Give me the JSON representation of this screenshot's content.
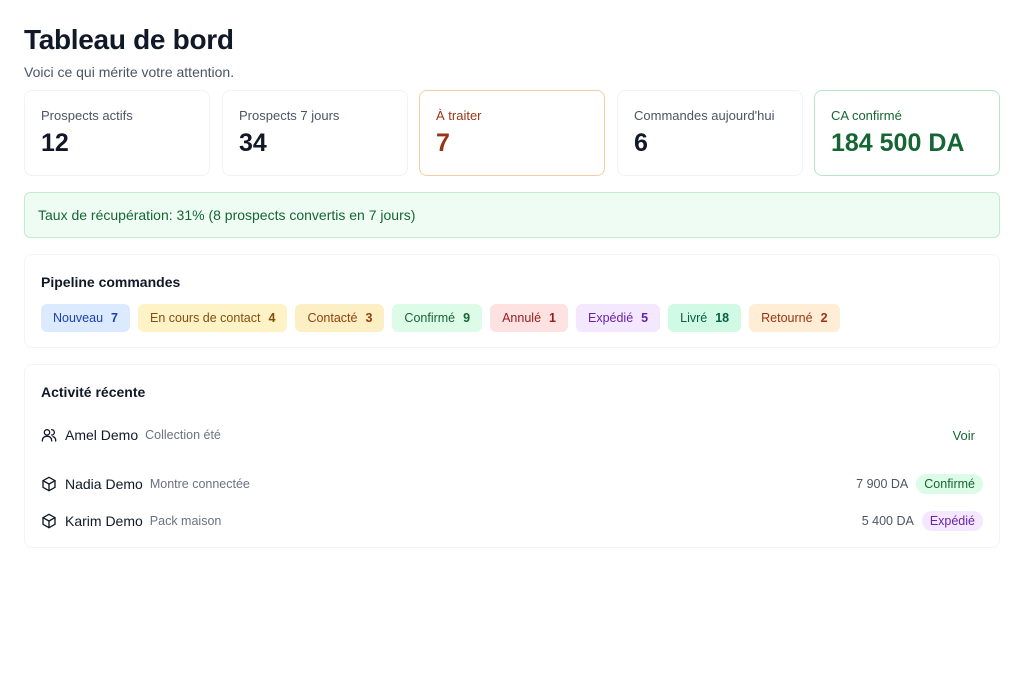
{
  "header": {
    "title": "Tableau de bord",
    "subtitle": "Voici ce qui mérite votre attention."
  },
  "stats": [
    {
      "label": "Prospects actifs",
      "value": "12"
    },
    {
      "label": "Prospects 7 jours",
      "value": "34"
    },
    {
      "label": "À traiter",
      "value": "7"
    },
    {
      "label": "Commandes aujourd'hui",
      "value": "6"
    },
    {
      "label": "CA confirmé",
      "value": "184 500 DA"
    }
  ],
  "recovery": {
    "text": "Taux de récupération: 31% (8 prospects convertis en 7 jours)"
  },
  "pipeline": {
    "title": "Pipeline commandes",
    "stages": [
      {
        "label": "Nouveau",
        "count": "7",
        "bg": "#dbeafe",
        "color": "#1e40af"
      },
      {
        "label": "En cours de contact",
        "count": "4",
        "bg": "#fef3c7",
        "color": "#854d0e"
      },
      {
        "label": "Contacté",
        "count": "3",
        "bg": "#fdefc4",
        "color": "#92400e"
      },
      {
        "label": "Confirmé",
        "count": "9",
        "bg": "#dcfce7",
        "color": "#166534"
      },
      {
        "label": "Annulé",
        "count": "1",
        "bg": "#fee2e2",
        "color": "#991b1b"
      },
      {
        "label": "Expédié",
        "count": "5",
        "bg": "#f3e8ff",
        "color": "#6b21a8"
      },
      {
        "label": "Livré",
        "count": "18",
        "bg": "#d1fae5",
        "color": "#065f46"
      },
      {
        "label": "Retourné",
        "count": "2",
        "bg": "#ffedd5",
        "color": "#9a3412"
      }
    ]
  },
  "activity": {
    "title": "Activité récente",
    "items": [
      {
        "icon": "users-icon",
        "name": "Amel Demo",
        "desc": "Collection été",
        "link": "Voir"
      },
      {
        "icon": "package-icon",
        "name": "Nadia Demo",
        "desc": "Montre connectée",
        "amount": "7 900 DA",
        "status": "Confirmé",
        "status_bg": "#dcfce7",
        "status_color": "#166534"
      },
      {
        "icon": "package-icon",
        "name": "Karim Demo",
        "desc": "Pack maison",
        "amount": "5 400 DA",
        "status": "Expédié",
        "status_bg": "#f3e8ff",
        "status_color": "#6b21a8"
      }
    ]
  }
}
